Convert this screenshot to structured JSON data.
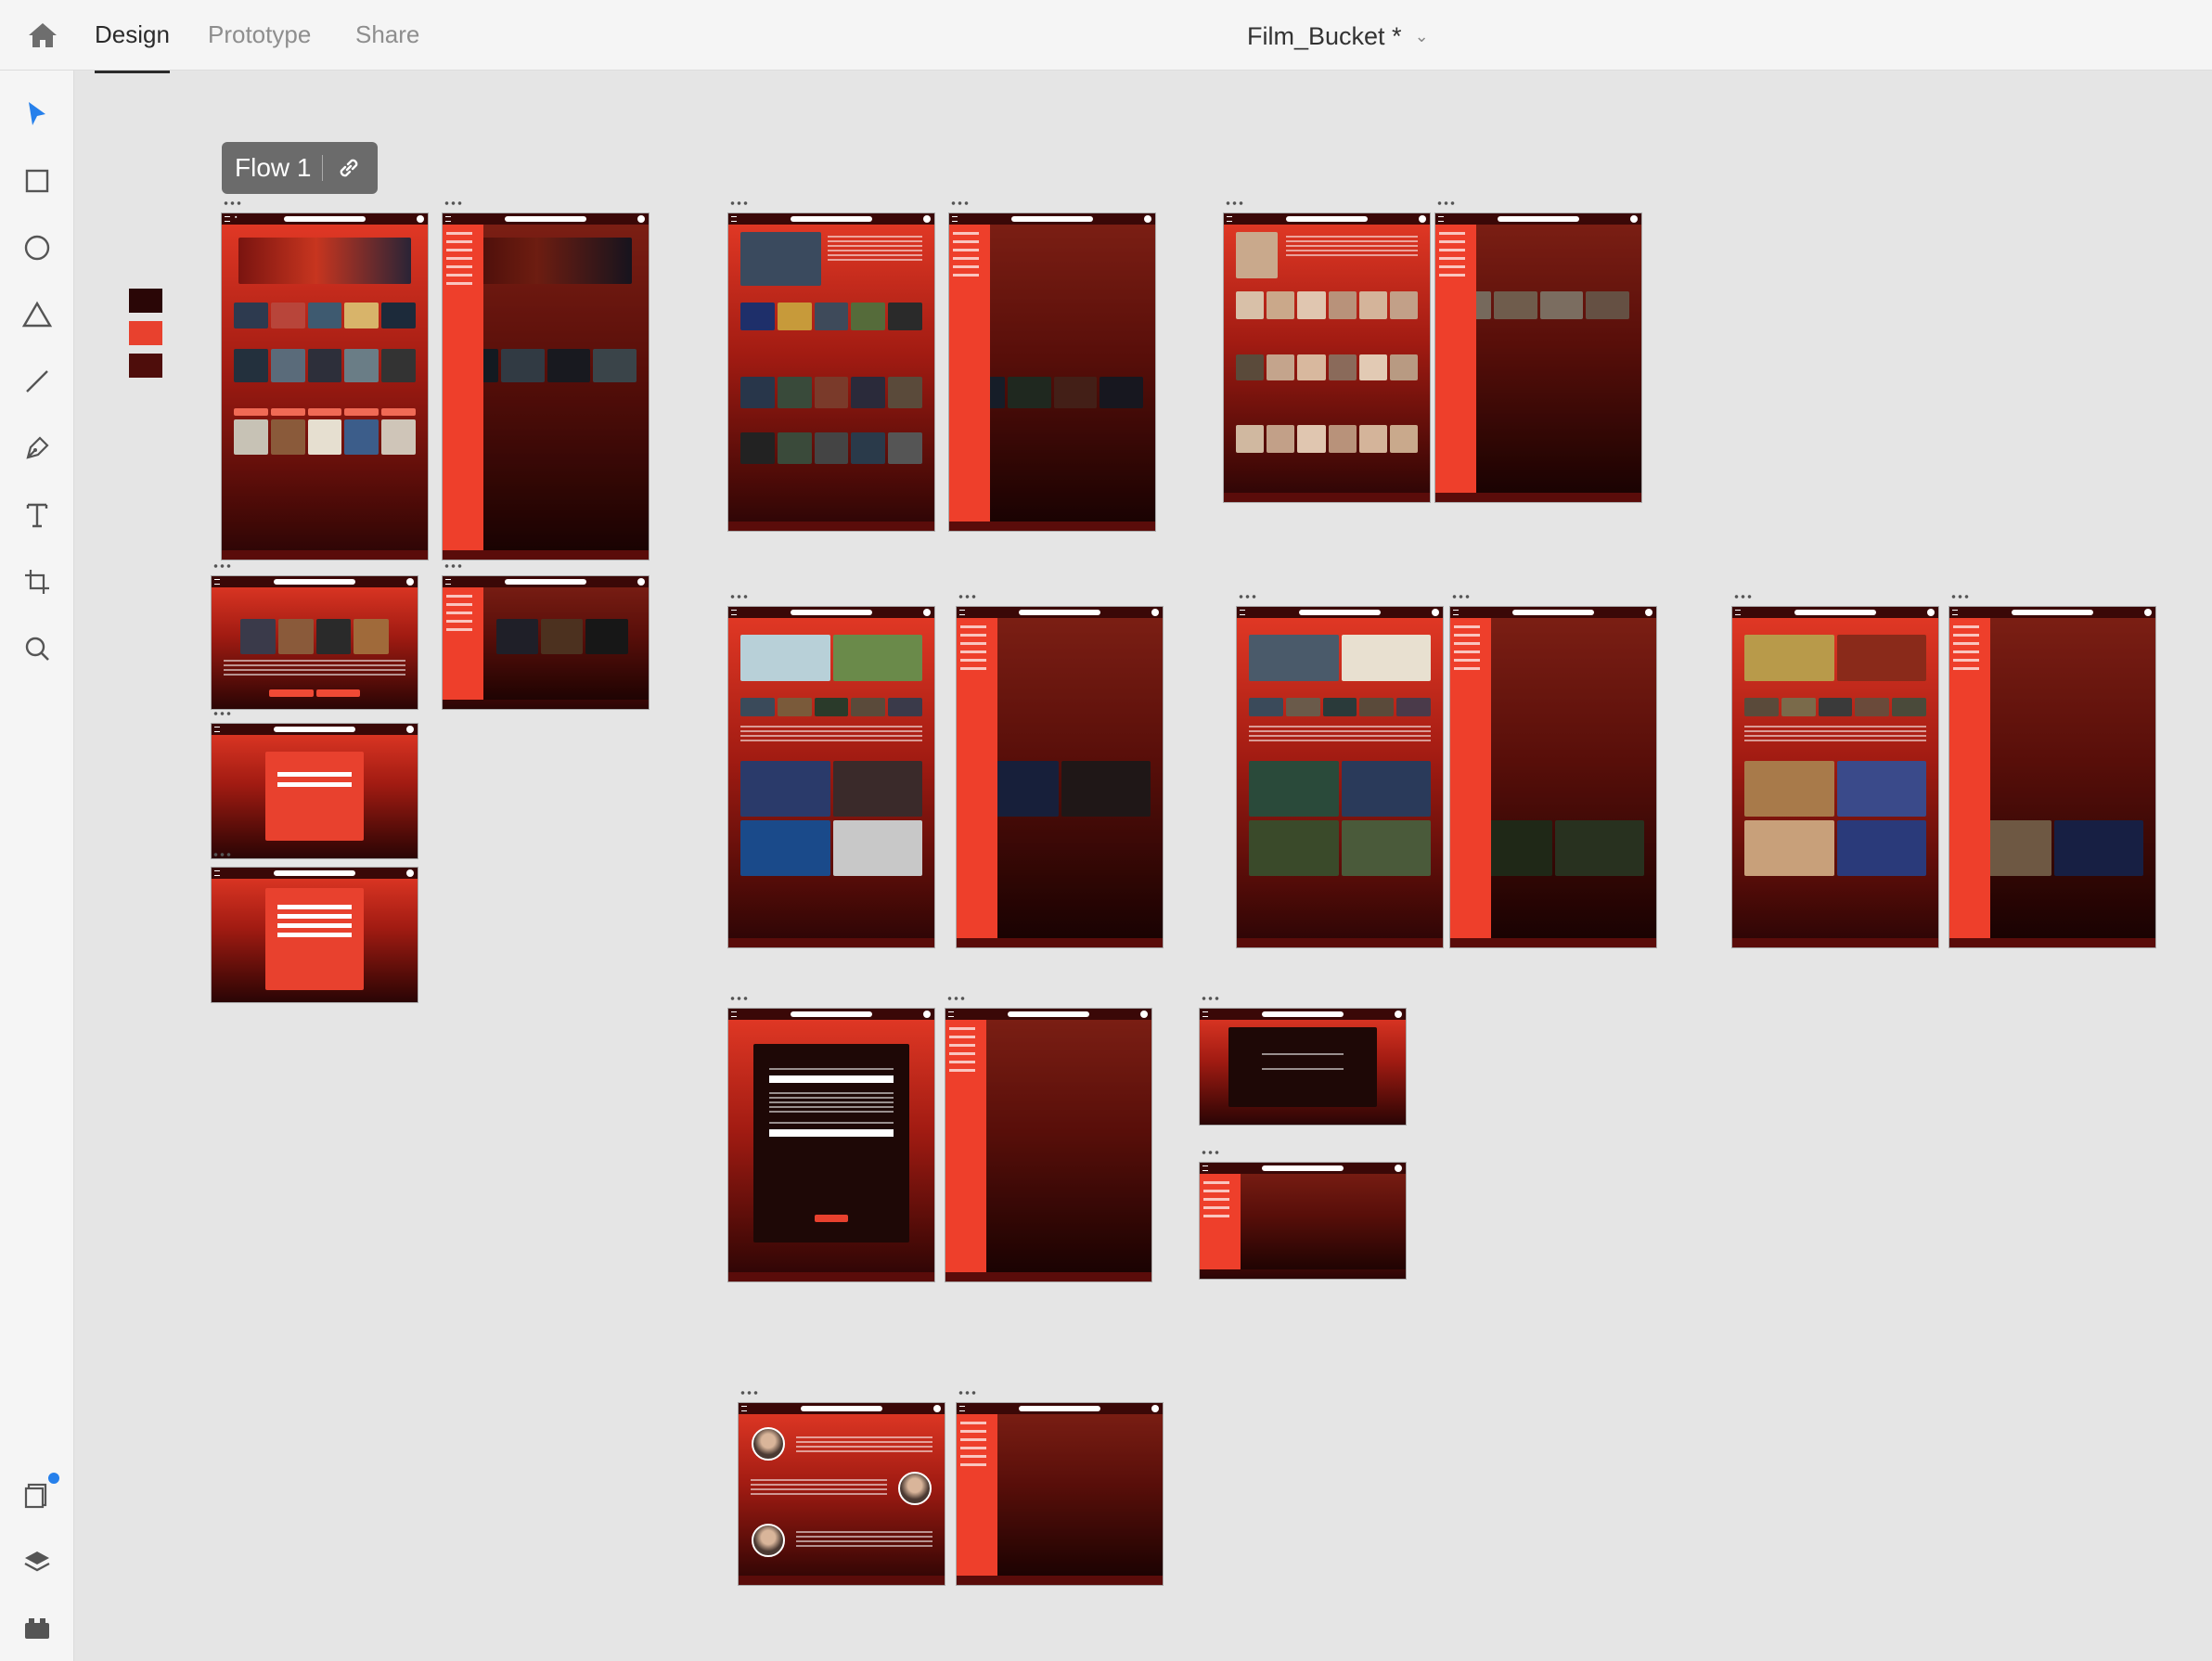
{
  "header": {
    "tabs": [
      {
        "label": "Design",
        "active": true
      },
      {
        "label": "Prototype",
        "active": false
      },
      {
        "label": "Share",
        "active": false
      }
    ],
    "document_title": "Film_Bucket *"
  },
  "toolbar": {
    "tools": [
      "select-tool",
      "rectangle-tool",
      "ellipse-tool",
      "triangle-tool",
      "line-tool",
      "pen-tool",
      "text-tool",
      "artboard-tool",
      "zoom-tool"
    ],
    "bottom": [
      "plugins-panel",
      "layers-panel",
      "assets-panel"
    ]
  },
  "canvas": {
    "flow_label": "Flow 1",
    "swatches": [
      "#2a0606",
      "#e8412e",
      "#4e0d0b"
    ]
  },
  "colors": {
    "accent": "#e8412e",
    "dark": "#2a0505",
    "chrome": "#f5f5f5"
  }
}
